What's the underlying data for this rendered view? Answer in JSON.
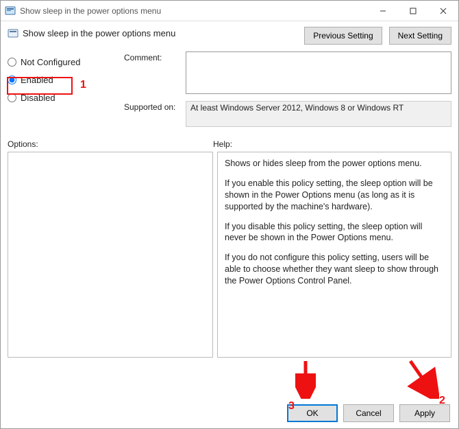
{
  "window": {
    "title": "Show sleep in the power options menu"
  },
  "header": {
    "policy_title": "Show sleep in the power options menu",
    "prev_label": "Previous Setting",
    "next_label": "Next Setting"
  },
  "state": {
    "not_configured_label": "Not Configured",
    "enabled_label": "Enabled",
    "disabled_label": "Disabled",
    "selected": "enabled"
  },
  "fields": {
    "comment_label": "Comment:",
    "comment_value": "",
    "supported_label": "Supported on:",
    "supported_value": "At least Windows Server 2012, Windows 8 or Windows RT"
  },
  "panes": {
    "options_label": "Options:",
    "help_label": "Help:",
    "help_p1": "Shows or hides sleep from the power options menu.",
    "help_p2": "If you enable this policy setting, the sleep option will be shown in the Power Options menu (as long as it is supported by the machine's hardware).",
    "help_p3": "If you disable this policy setting, the sleep option will never be shown in the Power Options menu.",
    "help_p4": "If you do not configure this policy setting, users will be able to choose whether they want sleep to show through the Power Options Control Panel."
  },
  "footer": {
    "ok_label": "OK",
    "cancel_label": "Cancel",
    "apply_label": "Apply"
  },
  "annotations": {
    "one": "1",
    "two": "2",
    "three": "3"
  }
}
